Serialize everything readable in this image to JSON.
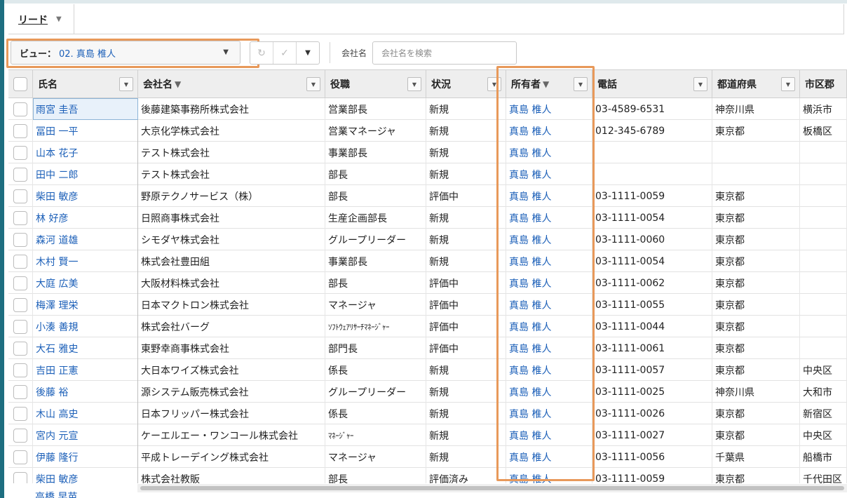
{
  "tabbar": {
    "tab_label": "リード"
  },
  "toolbar": {
    "view_prefix": "ビュー：",
    "view_value": "02. 真島 椎人",
    "search_label": "会社名",
    "search_placeholder": "会社名を検索"
  },
  "columns": [
    {
      "key": "name",
      "label": "氏名",
      "sorted": false
    },
    {
      "key": "company",
      "label": "会社名",
      "sorted": true
    },
    {
      "key": "title",
      "label": "役職",
      "sorted": false
    },
    {
      "key": "status",
      "label": "状況",
      "sorted": false
    },
    {
      "key": "owner",
      "label": "所有者",
      "sorted": true
    },
    {
      "key": "phone",
      "label": "電話",
      "sorted": false
    },
    {
      "key": "pref",
      "label": "都道府県",
      "sorted": false
    },
    {
      "key": "city",
      "label": "市区郡",
      "sorted": false
    }
  ],
  "rows": [
    {
      "name": "雨宮 圭吾",
      "company": "後藤建築事務所株式会社",
      "title": "営業部長",
      "status": "新規",
      "owner": "真島 椎人",
      "phone": "03-4589-6531",
      "pref": "神奈川県",
      "city": "横浜市"
    },
    {
      "name": "冨田 一平",
      "company": "大京化学株式会社",
      "title": "営業マネージャ",
      "status": "新規",
      "owner": "真島 椎人",
      "phone": "012-345-6789",
      "pref": "東京都",
      "city": "板橋区"
    },
    {
      "name": "山本 花子",
      "company": "テスト株式会社",
      "title": "事業部長",
      "status": "新規",
      "owner": "真島 椎人",
      "phone": "",
      "pref": "",
      "city": ""
    },
    {
      "name": "田中 二郎",
      "company": "テスト株式会社",
      "title": "部長",
      "status": "新規",
      "owner": "真島 椎人",
      "phone": "",
      "pref": "",
      "city": ""
    },
    {
      "name": "柴田 敏彦",
      "company": "野原テクノサービス（株）",
      "title": "部長",
      "status": "評価中",
      "owner": "真島 椎人",
      "phone": "03-1111-0059",
      "pref": "東京都",
      "city": ""
    },
    {
      "name": "林 好彦",
      "company": "日照商事株式会社",
      "title": "生産企画部長",
      "status": "新規",
      "owner": "真島 椎人",
      "phone": "03-1111-0054",
      "pref": "東京都",
      "city": ""
    },
    {
      "name": "森河 道雄",
      "company": "シモダヤ株式会社",
      "title": "グループリーダー",
      "status": "新規",
      "owner": "真島 椎人",
      "phone": "03-1111-0060",
      "pref": "東京都",
      "city": ""
    },
    {
      "name": "木村 賢一",
      "company": "株式会社豊田組",
      "title": "事業部長",
      "status": "新規",
      "owner": "真島 椎人",
      "phone": "03-1111-0054",
      "pref": "東京都",
      "city": ""
    },
    {
      "name": "大庭 広美",
      "company": "大阪材料株式会社",
      "title": "部長",
      "status": "評価中",
      "owner": "真島 椎人",
      "phone": "03-1111-0062",
      "pref": "東京都",
      "city": ""
    },
    {
      "name": "梅澤 理栄",
      "company": "日本マクトロン株式会社",
      "title": "マネージャ",
      "status": "評価中",
      "owner": "真島 椎人",
      "phone": "03-1111-0055",
      "pref": "東京都",
      "city": ""
    },
    {
      "name": "小湊 善規",
      "company": "株式会社バーグ",
      "title": "ｿﾌﾄｳｪｱﾘｻｰﾁﾏﾈｰｼﾞｬｰ",
      "status": "評価中",
      "owner": "真島 椎人",
      "phone": "03-1111-0044",
      "pref": "東京都",
      "city": ""
    },
    {
      "name": "大石 雅史",
      "company": "東野幸商事株式会社",
      "title": "部門長",
      "status": "評価中",
      "owner": "真島 椎人",
      "phone": "03-1111-0061",
      "pref": "東京都",
      "city": ""
    },
    {
      "name": "吉田 正憲",
      "company": "大日本ワイズ株式会社",
      "title": "係長",
      "status": "新規",
      "owner": "真島 椎人",
      "phone": "03-1111-0057",
      "pref": "東京都",
      "city": "中央区"
    },
    {
      "name": "後藤 裕",
      "company": "源システム販売株式会社",
      "title": "グループリーダー",
      "status": "新規",
      "owner": "真島 椎人",
      "phone": "03-1111-0025",
      "pref": "神奈川県",
      "city": "大和市"
    },
    {
      "name": "木山 高史",
      "company": "日本フリッパー株式会社",
      "title": "係長",
      "status": "新規",
      "owner": "真島 椎人",
      "phone": "03-1111-0026",
      "pref": "東京都",
      "city": "新宿区"
    },
    {
      "name": "宮内 元宣",
      "company": "ケーエルエー・ワンコール株式会社",
      "title": "ﾏﾈｰｼﾞｬｰ",
      "status": "新規",
      "owner": "真島 椎人",
      "phone": "03-1111-0027",
      "pref": "東京都",
      "city": "中央区"
    },
    {
      "name": "伊藤 隆行",
      "company": "平成トレーデイング株式会社",
      "title": "マネージャ",
      "status": "新規",
      "owner": "真島 椎人",
      "phone": "03-1111-0056",
      "pref": "千葉県",
      "city": "船橋市"
    },
    {
      "name": "柴田 敏彦",
      "company": "株式会社教販",
      "title": "部長",
      "status": "評価済み",
      "owner": "真島 椎人",
      "phone": "03-1111-0059",
      "pref": "東京都",
      "city": "千代田区"
    }
  ],
  "cutoff_row_name": "高橋 早苗",
  "colors": {
    "link": "#1b5fb8",
    "highlight": "#e8995a",
    "accent": "#1e6e80"
  }
}
